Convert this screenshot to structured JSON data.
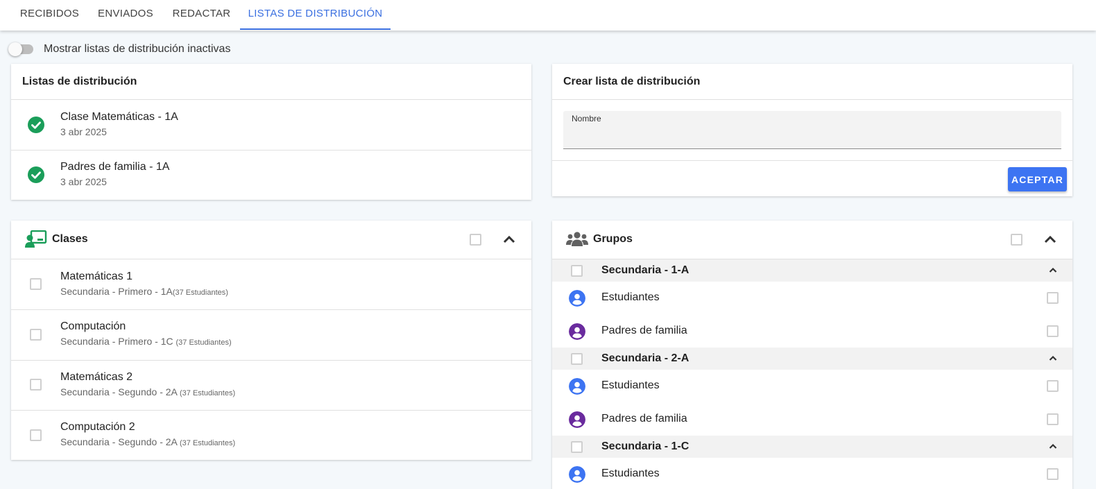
{
  "tabs": [
    {
      "label": "RECIBIDOS"
    },
    {
      "label": "ENVIADOS"
    },
    {
      "label": "REDACTAR"
    },
    {
      "label": "LISTAS DE DISTRIBUCIÓN",
      "active": true
    }
  ],
  "toggle": {
    "label": "Mostrar listas de distribución inactivas",
    "on": false
  },
  "lists_card": {
    "title": "Listas de distribución",
    "items": [
      {
        "name": "Clase Matemáticas - 1A",
        "date": "3 abr 2025",
        "icon": "check-circle-icon"
      },
      {
        "name": "Padres de familia - 1A",
        "date": "3 abr 2025",
        "icon": "check-circle-icon"
      }
    ]
  },
  "create_card": {
    "title": "Crear lista de distribución",
    "name_label": "Nombre",
    "name_value": "",
    "accept_label": "ACEPTAR"
  },
  "classes_card": {
    "title": "Clases",
    "icon": "teacher-board-icon",
    "items": [
      {
        "name": "Matemáticas 1",
        "detail": "Secundaria - Primero - 1A",
        "count": "(37 Estudiantes)"
      },
      {
        "name": "Computación",
        "detail": "Secundaria - Primero - 1C",
        "count": "(37 Estudiantes)"
      },
      {
        "name": "Matemáticas 2",
        "detail": "Secundaria - Segundo - 2A",
        "count": "(37 Estudiantes)"
      },
      {
        "name": "Computación 2",
        "detail": "Secundaria - Segundo - 2A",
        "count": "(37 Estudiantes)"
      }
    ]
  },
  "groups_card": {
    "title": "Grupos",
    "icon": "people-group-icon",
    "groups": [
      {
        "name": "Secundaria - 1-A",
        "members": [
          "Estudiantes",
          "Padres de familia"
        ]
      },
      {
        "name": "Secundaria - 2-A",
        "members": [
          "Estudiantes",
          "Padres de familia"
        ]
      },
      {
        "name": "Secundaria - 1-C",
        "members": [
          "Estudiantes"
        ]
      }
    ]
  },
  "colors": {
    "accent": "#3a6fe0",
    "button": "#3d74f2",
    "success": "#1b9e5a",
    "student_avatar": "#3d74f2",
    "parent_avatar": "#6a2b9e"
  }
}
